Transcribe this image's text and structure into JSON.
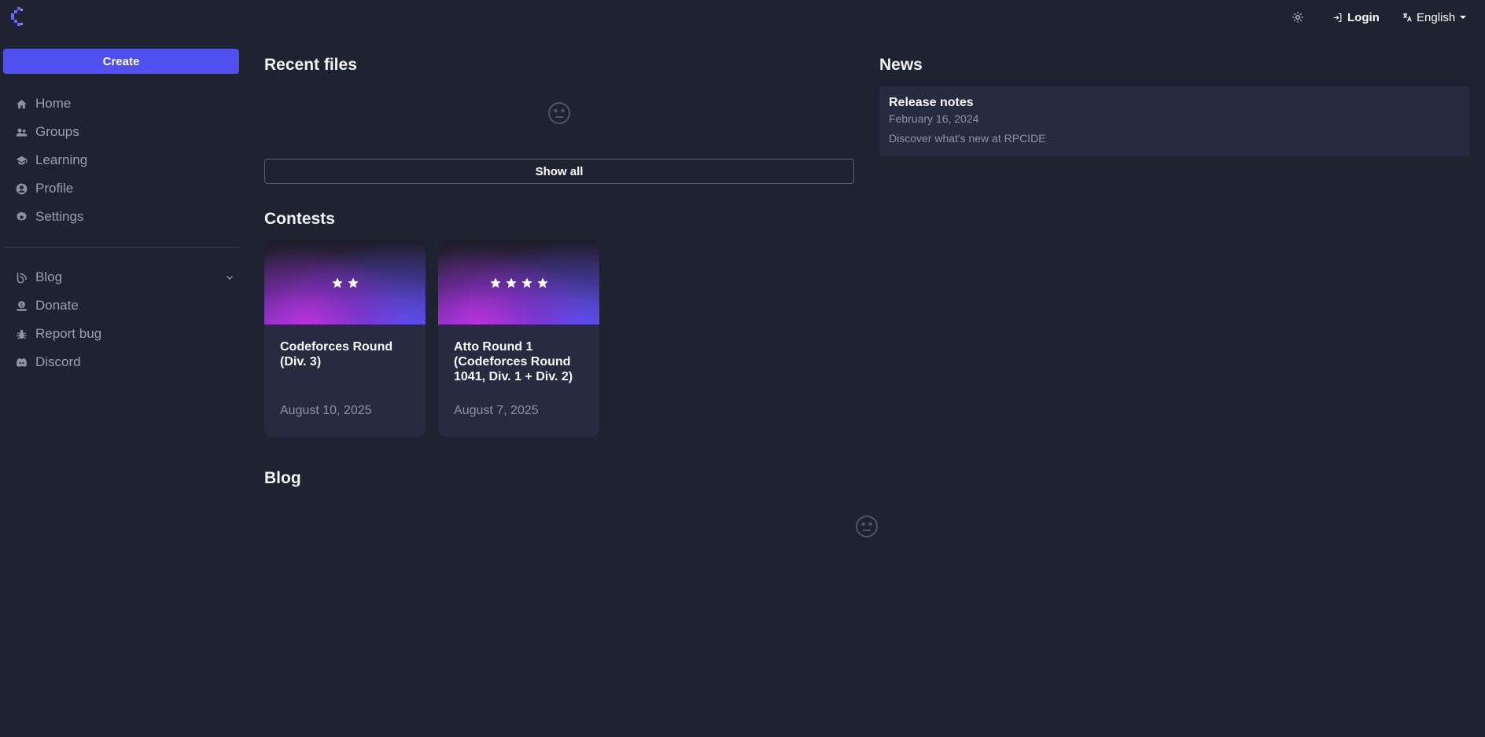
{
  "header": {
    "logo": "app-logo",
    "theme_icon": "sun-icon",
    "login_label": "Login",
    "language_label": "English"
  },
  "sidebar": {
    "create_label": "Create",
    "items": [
      {
        "label": "Home",
        "icon": "home-icon"
      },
      {
        "label": "Groups",
        "icon": "groups-icon"
      },
      {
        "label": "Learning",
        "icon": "graduation-cap-icon"
      },
      {
        "label": "Profile",
        "icon": "user-circle-icon"
      },
      {
        "label": "Settings",
        "icon": "gear-icon"
      }
    ],
    "secondary_items": [
      {
        "label": "Blog",
        "icon": "blog-icon"
      },
      {
        "label": "Donate",
        "icon": "donate-icon"
      },
      {
        "label": "Report bug",
        "icon": "bug-icon"
      },
      {
        "label": "Discord",
        "icon": "discord-icon"
      }
    ]
  },
  "main": {
    "recent_files": {
      "title": "Recent files",
      "show_all_label": "Show all"
    },
    "contests": {
      "title": "Contests",
      "items": [
        {
          "title": "Codeforces Round (Div. 3)",
          "date": "August 10, 2025",
          "stars": 2
        },
        {
          "title": "Atto Round 1 (Codeforces Round 1041, Div. 1 + Div. 2)",
          "date": "August 7, 2025",
          "stars": 4
        }
      ]
    },
    "blog": {
      "title": "Blog"
    }
  },
  "news": {
    "title": "News",
    "items": [
      {
        "title": "Release notes",
        "date": "February 16, 2024",
        "description": "Discover what's new at RPCIDE"
      }
    ]
  },
  "colors": {
    "background": "#1f2230",
    "accent": "#5050f0",
    "card": "#282b3f",
    "muted_text": "#9aa0b2"
  }
}
